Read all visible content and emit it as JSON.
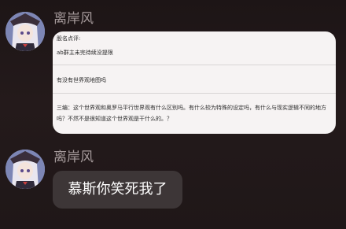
{
  "messages": [
    {
      "sender": "离岸风",
      "avatar_icon": "anime-girl-avatar",
      "type": "card",
      "lines": [
        "股名点评:",
        "ab群主未完待续没提限",
        "有没有世界观地图吗",
        "三编：这个世界观和奥罗马平行世界观有什么区别吗。有什么较为特殊的设定吗，有什么与现实逻辑不同的地方吗？不然不是很知道这个世界观是干什么的。？"
      ]
    },
    {
      "sender": "离岸风",
      "avatar_icon": "anime-girl-avatar",
      "type": "text",
      "text": "慕斯你笑死我了"
    }
  ],
  "colors": {
    "background": "#211819",
    "name": "#a59a9b",
    "card": "#f6f3f3",
    "bubble": "#3d3637",
    "bubble_text": "#ffffff"
  }
}
